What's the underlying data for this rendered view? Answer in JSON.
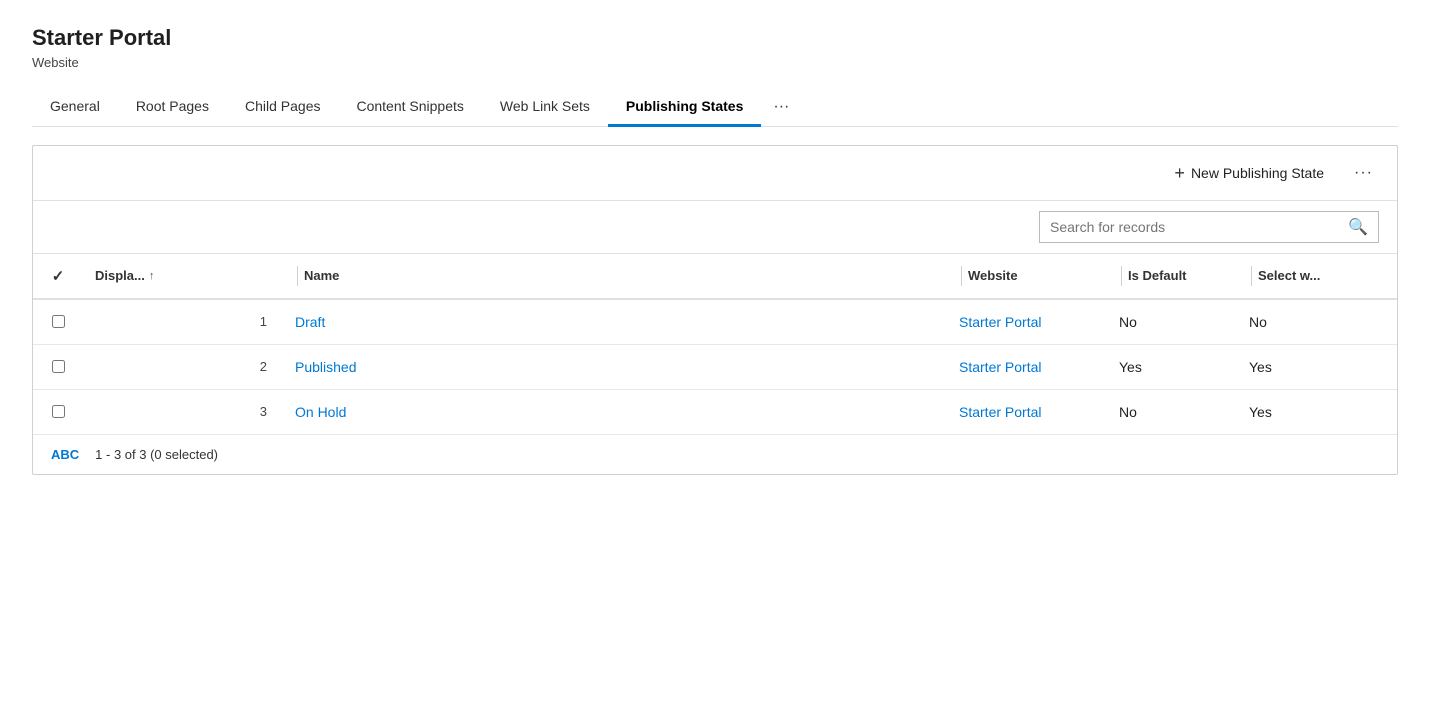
{
  "header": {
    "title": "Starter Portal",
    "subtitle": "Website"
  },
  "tabs": {
    "items": [
      {
        "label": "General",
        "active": false
      },
      {
        "label": "Root Pages",
        "active": false
      },
      {
        "label": "Child Pages",
        "active": false
      },
      {
        "label": "Content Snippets",
        "active": false
      },
      {
        "label": "Web Link Sets",
        "active": false
      },
      {
        "label": "Publishing States",
        "active": true
      }
    ],
    "more_label": "···"
  },
  "toolbar": {
    "new_btn_label": "New Publishing State",
    "plus_icon": "+",
    "ellipsis": "···"
  },
  "search": {
    "placeholder": "Search for records",
    "icon": "🔍"
  },
  "table": {
    "columns": [
      {
        "label": "",
        "key": "check"
      },
      {
        "label": "Displa...↑",
        "key": "display_order"
      },
      {
        "label": "Name",
        "key": "name"
      },
      {
        "label": "Website",
        "key": "website"
      },
      {
        "label": "Is Default",
        "key": "is_default"
      },
      {
        "label": "Select w...",
        "key": "select_w"
      }
    ],
    "rows": [
      {
        "display_order": "1",
        "name": "Draft",
        "website": "Starter Portal",
        "is_default": "No",
        "select_w": "No"
      },
      {
        "display_order": "2",
        "name": "Published",
        "website": "Starter Portal",
        "is_default": "Yes",
        "select_w": "Yes"
      },
      {
        "display_order": "3",
        "name": "On Hold",
        "website": "Starter Portal",
        "is_default": "No",
        "select_w": "Yes"
      }
    ]
  },
  "footer": {
    "abc_label": "ABC",
    "count_label": "1 - 3 of 3 (0 selected)"
  }
}
